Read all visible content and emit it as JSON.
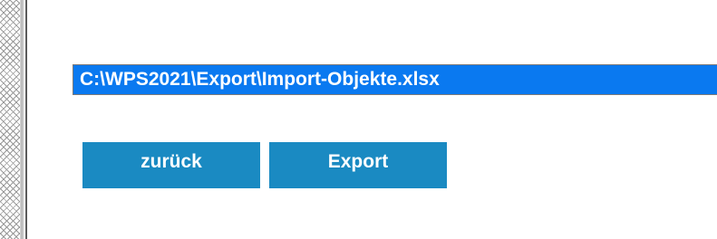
{
  "export_form": {
    "file_path": "C:\\WPS2021\\Export\\Import-Objekte.xlsx",
    "back_label": "zurück",
    "export_label": "Export"
  },
  "colors": {
    "field_selection": "#0a79f0",
    "button": "#1a8ac2",
    "text_on_accent": "#ffffff"
  }
}
